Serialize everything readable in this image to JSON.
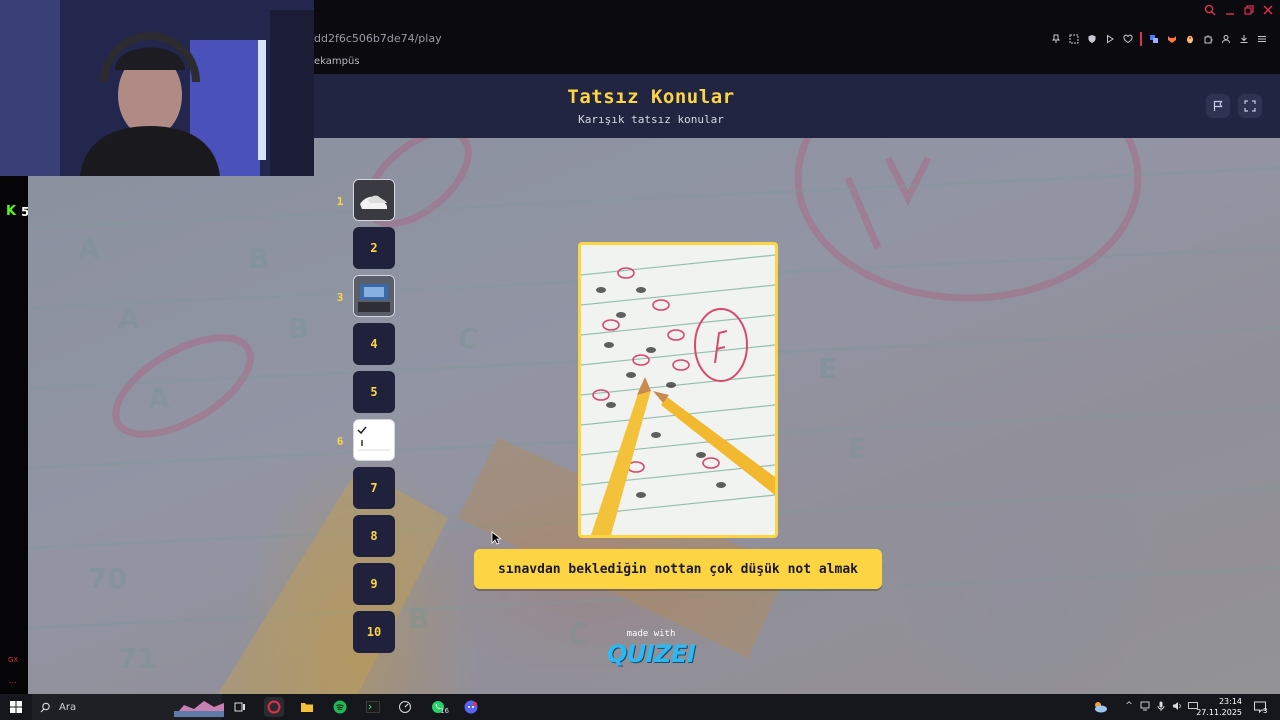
{
  "browser": {
    "url_fragment": "dd2f6c506b7de74/play",
    "bookmark": "ekampüs"
  },
  "sidebar": {
    "viewer_count": "5",
    "gx_label": "GX",
    "more_label": "..."
  },
  "app": {
    "title": "Tatsız Konular",
    "subtitle": "Karışık tatsız konular"
  },
  "questions": [
    {
      "number": "1",
      "label": "1",
      "is_thumb": true
    },
    {
      "number": "",
      "label": "2",
      "is_thumb": false
    },
    {
      "number": "3",
      "label": "3",
      "is_thumb": true
    },
    {
      "number": "",
      "label": "4",
      "is_thumb": false
    },
    {
      "number": "",
      "label": "5",
      "is_thumb": false
    },
    {
      "number": "6",
      "label": "6",
      "is_thumb": true
    },
    {
      "number": "",
      "label": "7",
      "is_thumb": false
    },
    {
      "number": "",
      "label": "8",
      "is_thumb": false
    },
    {
      "number": "",
      "label": "9",
      "is_thumb": false
    },
    {
      "number": "",
      "label": "10",
      "is_thumb": false
    }
  ],
  "card": {
    "answer": "sınavdan beklediğin nottan çok düşük not almak"
  },
  "footer": {
    "made_with": "made with",
    "brand": "QUIZEI"
  },
  "taskbar": {
    "search_placeholder": "Ara",
    "whatsapp_badge": "16",
    "time": "23:14",
    "date": "27.11.2025",
    "notification_count": "3"
  },
  "colors": {
    "accent": "#fdd542",
    "header_bg": "#222542",
    "tile_bg": "#20223d",
    "brand": "#2fb8f0"
  }
}
